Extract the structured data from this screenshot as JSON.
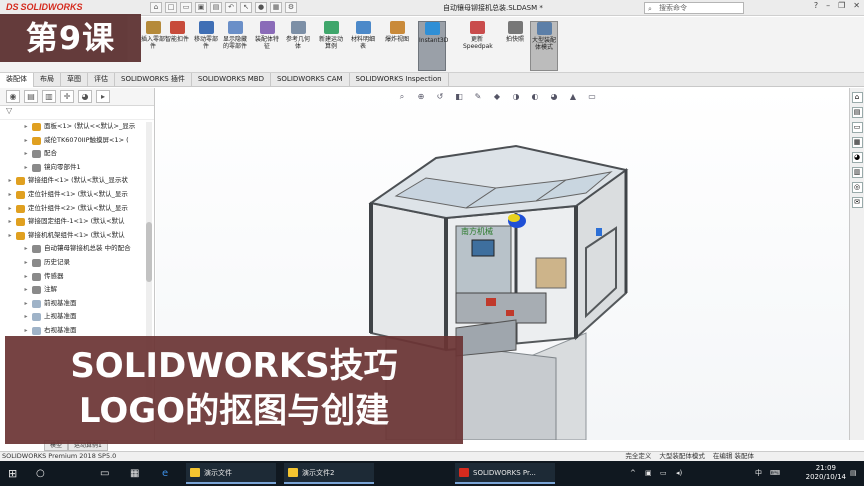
{
  "app": {
    "logo_brand": "DS",
    "logo_name": "SOLIDWORKS",
    "document_title": "自动镶母铆接机总装.SLDASM *",
    "search_placeholder": "搜索命令"
  },
  "overlay": {
    "lesson_badge": "第9课",
    "caption_line1": "SOLIDWORKS技巧",
    "caption_line2": "LOGO的抠图与创建"
  },
  "ribbon": {
    "buttons": [
      {
        "label": "插入零部件",
        "icon": "insert-component-icon",
        "color": "#b58a3a"
      },
      {
        "label": "智能扣件",
        "icon": "smart-fastener-icon",
        "color": "#c74b3b"
      },
      {
        "label": "移动零部件",
        "icon": "move-component-icon",
        "color": "#3f6fb5"
      },
      {
        "label": "显示隐藏的零部件",
        "icon": "show-hidden-icon",
        "color": "#6a8fc8"
      },
      {
        "label": "装配体特征",
        "icon": "assembly-feature-icon",
        "color": "#8a6bb8"
      },
      {
        "label": "参考几何体",
        "icon": "reference-geometry-icon",
        "color": "#7c8fa6"
      },
      {
        "label": "新建运动算例",
        "icon": "motion-study-icon",
        "color": "#3fa66b"
      },
      {
        "label": "材料明细表",
        "icon": "bom-icon",
        "color": "#4c89c9"
      },
      {
        "label": "爆炸视图",
        "icon": "exploded-view-icon",
        "color": "#c98a3a"
      },
      {
        "label": "Instant3D",
        "icon": "instant3d-icon",
        "color": "#2f8fd6"
      },
      {
        "label": "更新Speedpak",
        "icon": "speedpak-icon",
        "color": "#c94c4c"
      },
      {
        "label": "拍快照",
        "icon": "snapshot-icon",
        "color": "#777777"
      },
      {
        "label": "大型装配体模式",
        "icon": "large-assembly-icon",
        "color": "#5c7fa8"
      }
    ]
  },
  "command_tabs": [
    "装配体",
    "布局",
    "草图",
    "评估",
    "SOLIDWORKS 插件",
    "SOLIDWORKS MBD",
    "SOLIDWORKS CAM",
    "SOLIDWORKS Inspection"
  ],
  "tree": [
    {
      "label": "面板<1> (默认<<默认>_显示",
      "indent": 1,
      "icon_color": "#e0a020"
    },
    {
      "label": "威伦TK6070IIP触摸屏<1> (",
      "indent": 1,
      "icon_color": "#e0a020"
    },
    {
      "label": "配合",
      "indent": 1,
      "icon_color": "#8a8a8a"
    },
    {
      "label": "镜向零部件1",
      "indent": 1,
      "icon_color": "#8a8a8a"
    },
    {
      "label": "铆接组件<1> (默认<默认_显示状",
      "indent": 0,
      "icon_color": "#e0a020"
    },
    {
      "label": "定位针组件<1> (默认<默认_显示",
      "indent": 0,
      "icon_color": "#e0a020"
    },
    {
      "label": "定位针组件<2> (默认<默认_显示",
      "indent": 0,
      "icon_color": "#e0a020"
    },
    {
      "label": "铆接固定组件-1<1> (默认<默认",
      "indent": 0,
      "icon_color": "#e0a020"
    },
    {
      "label": "铆接机机架组件<1> (默认<默认",
      "indent": 0,
      "icon_color": "#e0a020"
    },
    {
      "label": "自动镶母铆接机总装 中的配合",
      "indent": 1,
      "icon_color": "#8a8a8a"
    },
    {
      "label": "历史记录",
      "indent": 1,
      "icon_color": "#8a8a8a"
    },
    {
      "label": "传感器",
      "indent": 1,
      "icon_color": "#8a8a8a"
    },
    {
      "label": "注解",
      "indent": 1,
      "icon_color": "#8a8a8a"
    },
    {
      "label": "前视基准面",
      "indent": 1,
      "icon_color": "#9fb3c8"
    },
    {
      "label": "上视基准面",
      "indent": 1,
      "icon_color": "#9fb3c8"
    },
    {
      "label": "右视基准面",
      "indent": 1,
      "icon_color": "#9fb3c8"
    }
  ],
  "machine": {
    "panel_text": "南方机械"
  },
  "bottom_tabs": [
    "模型",
    "运动算例1"
  ],
  "status": {
    "left": "SOLIDWORKS Premium 2018 SP5.0",
    "items": [
      "完全定义",
      "大型装配体模式",
      "在编辑 装配体"
    ]
  },
  "taskbar": {
    "apps": [
      "演示文件",
      "演示文件2",
      "SOLIDWORKS Pr..."
    ],
    "ime": "中",
    "time": "21:09",
    "date": "2020/10/14"
  }
}
